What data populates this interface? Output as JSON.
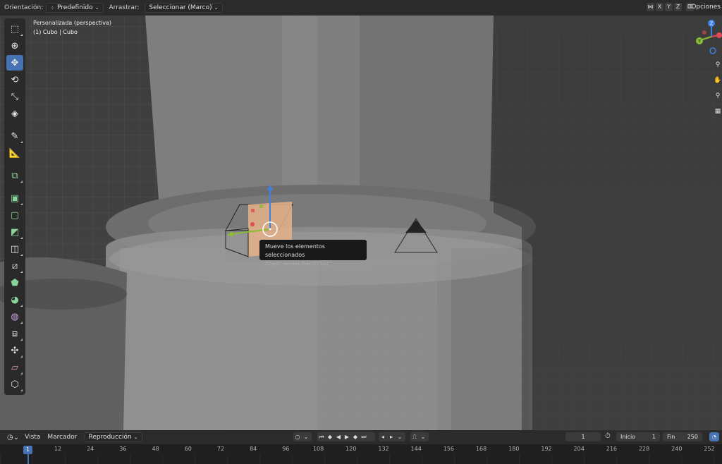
{
  "header": {
    "orientation_label": "Orientación:",
    "orientation_value": "Predefinido",
    "drag_label": "Arrastrar:",
    "drag_value": "Seleccionar (Marco)",
    "axes": [
      "X",
      "Y",
      "Z"
    ],
    "options_label": "Opciones"
  },
  "viewport": {
    "view_name": "Personalizada (perspectiva)",
    "object_info": "(1) Cubo | Cubo",
    "gizmo_axes": {
      "x": "X",
      "y": "Y",
      "z": "Z"
    },
    "tooltip_title": "Mueve los elementos seleccionados",
    "tooltip_shortcut": "Atajo: arrast-Ratón Izq",
    "colors": {
      "active_tool": "#4772b3",
      "x_axis": "#e04a57",
      "y_axis": "#8bbd36",
      "z_axis": "#3d82e0"
    }
  },
  "toolbar": {
    "tools": [
      "select-box",
      "cursor",
      "move",
      "rotate",
      "scale",
      "transform",
      "annotate",
      "measure",
      "add-cube",
      "extrude",
      "inset",
      "bevel",
      "loop-cut",
      "knife",
      "poly-build",
      "spin",
      "smooth",
      "shrink-fatten",
      "shear",
      "rip-region"
    ]
  },
  "timeline": {
    "menus": [
      "Vista",
      "Marcador",
      "Reproducción"
    ],
    "current_frame": "1",
    "start_label": "Inicio",
    "start_value": "1",
    "end_label": "Fin",
    "end_value": "250",
    "ruler_numbers": [
      "1",
      "12",
      "24",
      "36",
      "48",
      "60",
      "72",
      "84",
      "96",
      "108",
      "120",
      "132",
      "144",
      "156",
      "168",
      "180",
      "192",
      "204",
      "216",
      "228",
      "240",
      "252"
    ]
  }
}
